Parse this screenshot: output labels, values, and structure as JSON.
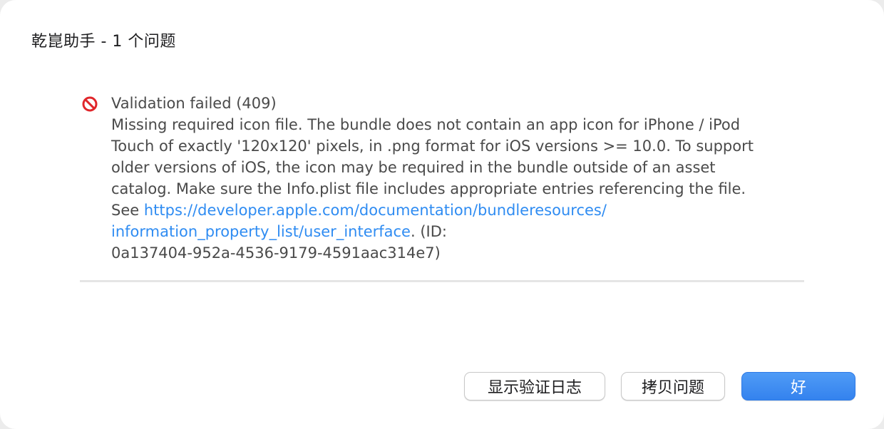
{
  "dialog": {
    "title": "乾崑助手 - 1 个问题"
  },
  "issue": {
    "icon": "prohibited-icon",
    "icon_color": "#e0262b",
    "heading": "Validation failed (409)",
    "lines": [
      "Missing required icon file. The bundle does not contain an app icon for iPhone / iPod",
      "Touch of exactly '120x120' pixels, in .png format for iOS versions >= 10.0. To support",
      "older versions of iOS, the icon may be required in the bundle outside of an asset",
      "catalog. Make sure the Info.plist file includes appropriate entries referencing the file."
    ],
    "see_prefix": "See ",
    "link_part1": "https://developer.apple.com/documentation/bundleresources/",
    "link_part2": "information_property_list/user_interface",
    "id_prefix": ". (ID:",
    "id_value": "0a137404-952a-4536-9179-4591aac314e7)",
    "link_color": "#2f8cf2"
  },
  "buttons": {
    "show_log": "显示验证日志",
    "copy_issue": "拷贝问题",
    "ok": "好"
  },
  "colors": {
    "primary_button": "#3a88f0",
    "text": "#4a4a4a"
  }
}
